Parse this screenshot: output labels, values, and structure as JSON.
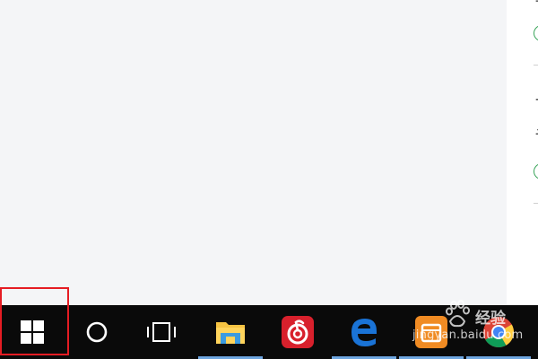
{
  "desktop": {
    "background": "#f4f5f7"
  },
  "side_panel": {
    "fragments": [
      "讠",
      "一",
      "讠"
    ]
  },
  "taskbar": {
    "background": "#0a0a0a",
    "items": [
      {
        "name": "start-button",
        "icon": "windows-logo-icon"
      },
      {
        "name": "cortana-button",
        "icon": "cortana-circle-icon"
      },
      {
        "name": "task-view-button",
        "icon": "task-view-icon"
      },
      {
        "name": "file-explorer-button",
        "icon": "folder-icon",
        "running": true
      },
      {
        "name": "netease-music-button",
        "icon": "netease-cloud-music-icon",
        "brand_color": "#d8202c"
      },
      {
        "name": "edge-button",
        "icon": "edge-icon",
        "running": true,
        "brand_color": "#1a73d6"
      },
      {
        "name": "orange-app-button",
        "icon": "orange-app-icon",
        "running": true,
        "brand_color": "#f08b23"
      },
      {
        "name": "chrome-button",
        "icon": "chrome-icon"
      }
    ],
    "running_indicator_color": "#6ea6e0"
  },
  "highlight": {
    "color": "#e51c23",
    "target": "start-button"
  },
  "watermark": {
    "text": "jingyan.baidu.com",
    "logo_text": "经验"
  }
}
